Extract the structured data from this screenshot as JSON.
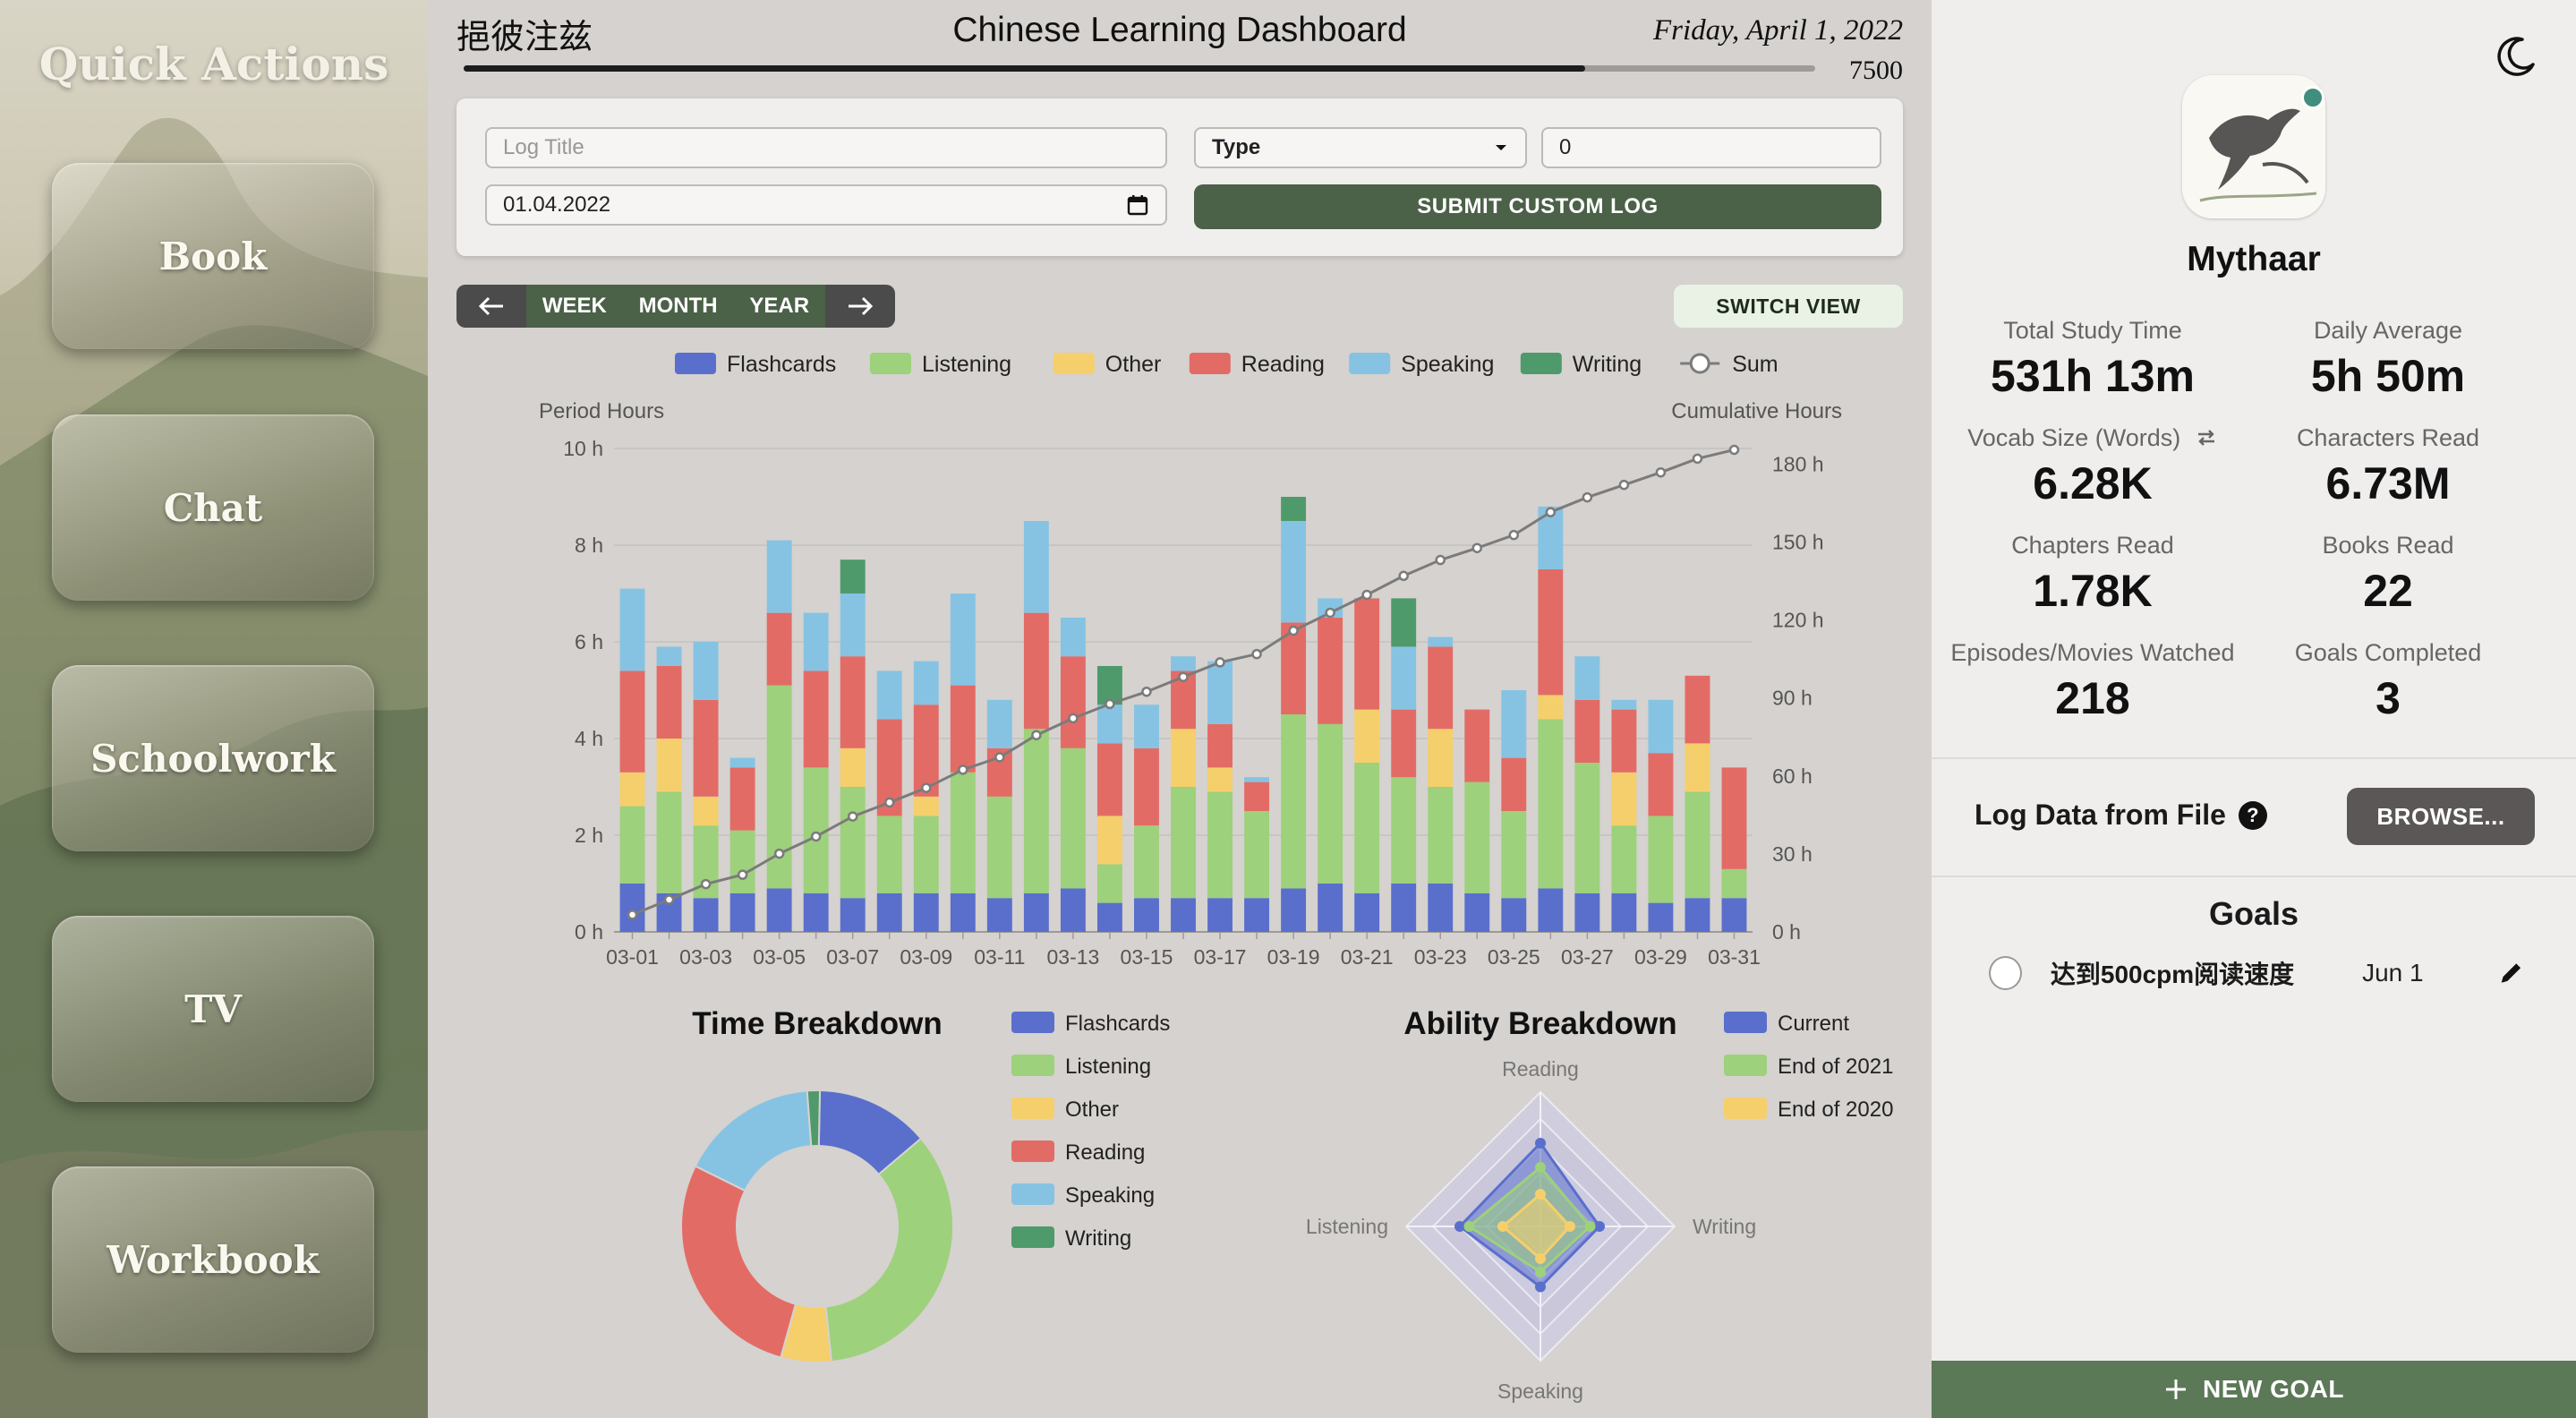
{
  "sidebar": {
    "title": "Quick Actions",
    "items": [
      {
        "label": "Book"
      },
      {
        "label": "Chat"
      },
      {
        "label": "Schoolwork"
      },
      {
        "label": "TV"
      },
      {
        "label": "Workbook"
      }
    ]
  },
  "header": {
    "calligraphy": "挹彼注兹",
    "title": "Chinese Learning Dashboard",
    "date": "Friday, April 1, 2022",
    "progress_label": "7500",
    "progress_fraction": 0.83
  },
  "log_form": {
    "title_placeholder": "Log Title",
    "type_label": "Type",
    "amount_value": "0",
    "date_value": "01.04.2022",
    "submit_label": "SUBMIT CUSTOM LOG"
  },
  "range_nav": {
    "week": "WEEK",
    "month": "MONTH",
    "year": "YEAR"
  },
  "switch_view_label": "SWITCH VIEW",
  "colors": {
    "Flashcards": "#5a6fcc",
    "Listening": "#9dd17b",
    "Other": "#f5cf6b",
    "Reading": "#e36b66",
    "Speaking": "#86c3e3",
    "Writing": "#4f9a6b",
    "Sum": "#7b7b7b"
  },
  "chart_data": [
    {
      "type": "bar",
      "stacked": true,
      "left_axis_label": "Period Hours",
      "right_axis_label": "Cumulative Hours",
      "ylim": [
        0,
        10
      ],
      "y2lim": [
        0,
        186
      ],
      "yticks": [
        "0 h",
        "2 h",
        "4 h",
        "6 h",
        "8 h",
        "10 h"
      ],
      "y2ticks": [
        "0 h",
        "30 h",
        "60 h",
        "90 h",
        "120 h",
        "150 h",
        "180 h"
      ],
      "legend": [
        "Flashcards",
        "Listening",
        "Other",
        "Reading",
        "Speaking",
        "Writing",
        "Sum"
      ],
      "categories": [
        "03-01",
        "03-02",
        "03-03",
        "03-04",
        "03-05",
        "03-06",
        "03-07",
        "03-08",
        "03-09",
        "03-10",
        "03-11",
        "03-12",
        "03-13",
        "03-14",
        "03-15",
        "03-16",
        "03-17",
        "03-18",
        "03-19",
        "03-20",
        "03-21",
        "03-22",
        "03-23",
        "03-24",
        "03-25",
        "03-26",
        "03-27",
        "03-28",
        "03-29",
        "03-30",
        "03-31"
      ],
      "tick_labels": [
        "03-01",
        "03-03",
        "03-05",
        "03-07",
        "03-09",
        "03-11",
        "03-13",
        "03-15",
        "03-17",
        "03-19",
        "03-21",
        "03-23",
        "03-25",
        "03-27",
        "03-29",
        "03-31"
      ],
      "series": [
        {
          "name": "Flashcards",
          "values": [
            1.0,
            0.8,
            0.7,
            0.8,
            0.9,
            0.8,
            0.7,
            0.8,
            0.8,
            0.8,
            0.7,
            0.8,
            0.9,
            0.6,
            0.7,
            0.7,
            0.7,
            0.7,
            0.9,
            1.0,
            0.8,
            1.0,
            1.0,
            0.8,
            0.7,
            0.9,
            0.8,
            0.8,
            0.6,
            0.7,
            0.7
          ]
        },
        {
          "name": "Listening",
          "values": [
            1.6,
            2.1,
            1.5,
            1.3,
            4.2,
            2.6,
            2.3,
            1.6,
            1.6,
            2.5,
            2.1,
            3.4,
            2.9,
            0.8,
            1.5,
            2.3,
            2.2,
            1.8,
            3.6,
            3.3,
            2.7,
            2.2,
            2.0,
            2.3,
            1.8,
            3.5,
            2.7,
            1.4,
            1.8,
            2.2,
            0.6
          ]
        },
        {
          "name": "Other",
          "values": [
            0.7,
            1.1,
            0.6,
            0,
            0,
            0,
            0.8,
            0,
            0.4,
            0,
            0,
            0,
            0,
            1.0,
            0,
            1.2,
            0.5,
            0,
            0,
            0,
            1.1,
            0,
            1.2,
            0,
            0,
            0.5,
            0,
            1.1,
            0,
            1.0,
            0
          ]
        },
        {
          "name": "Reading",
          "values": [
            2.1,
            1.5,
            2.0,
            1.3,
            1.5,
            2.0,
            1.9,
            2.0,
            1.9,
            1.8,
            1.0,
            2.4,
            1.9,
            1.5,
            1.6,
            1.2,
            0.9,
            0.6,
            1.9,
            2.2,
            2.3,
            1.4,
            1.7,
            1.5,
            1.1,
            2.6,
            1.3,
            1.3,
            1.3,
            1.4,
            2.1
          ]
        },
        {
          "name": "Speaking",
          "values": [
            1.7,
            0.4,
            1.2,
            0.2,
            1.5,
            1.2,
            1.3,
            1.0,
            0.9,
            1.9,
            1.0,
            1.9,
            0.8,
            0.8,
            0.9,
            0.3,
            1.3,
            0.1,
            2.1,
            0.4,
            0,
            1.3,
            0.2,
            0,
            1.4,
            1.3,
            0.9,
            0.2,
            1.1,
            0,
            0
          ]
        },
        {
          "name": "Writing",
          "values": [
            0,
            0,
            0,
            0,
            0,
            0,
            0.7,
            0,
            0,
            0,
            0,
            0,
            0,
            0.8,
            0,
            0,
            0,
            0,
            0.5,
            0,
            0,
            1.0,
            0,
            0,
            0,
            0,
            0,
            0,
            0,
            0,
            0
          ]
        }
      ],
      "sum_line": {
        "name": "Sum",
        "values": [
          6.6,
          12.4,
          18.4,
          22.0,
          30.1,
          36.7,
          44.4,
          49.8,
          55.4,
          62.4,
          67.2,
          75.7,
          82.2,
          87.7,
          92.4,
          98.1,
          103.7,
          106.9,
          115.9,
          122.8,
          129.7,
          137.0,
          143.1,
          147.7,
          152.7,
          161.5,
          167.2,
          172.0,
          176.8,
          182.1,
          185.5
        ]
      }
    },
    {
      "type": "pie",
      "donut": true,
      "title": "Time Breakdown",
      "categories": [
        "Flashcards",
        "Listening",
        "Other",
        "Reading",
        "Speaking",
        "Writing"
      ],
      "values": [
        13.5,
        34.5,
        6.0,
        28.0,
        16.5,
        1.5
      ]
    },
    {
      "type": "radar",
      "title": "Ability Breakdown",
      "axes": [
        "Reading",
        "Writing",
        "Speaking",
        "Listening"
      ],
      "series": [
        {
          "name": "Current",
          "values": [
            0.62,
            0.44,
            0.45,
            0.6
          ]
        },
        {
          "name": "End of 2021",
          "values": [
            0.44,
            0.37,
            0.34,
            0.53
          ]
        },
        {
          "name": "End of 2020",
          "values": [
            0.24,
            0.22,
            0.24,
            0.28
          ]
        }
      ],
      "series_colors": [
        "#5a6fcc",
        "#9dd17b",
        "#f5cf6b"
      ]
    }
  ],
  "profile": {
    "username": "Mythaar",
    "stats": [
      {
        "label": "Total Study Time",
        "value": "531h 13m"
      },
      {
        "label": "Daily Average",
        "value": "5h 50m"
      },
      {
        "label": "Vocab Size (Words)",
        "value": "6.28K"
      },
      {
        "label": "Characters Read",
        "value": "6.73M"
      },
      {
        "label": "Chapters Read",
        "value": "1.78K"
      },
      {
        "label": "Books Read",
        "value": "22"
      },
      {
        "label": "Episodes/Movies Watched",
        "value": "218"
      },
      {
        "label": "Goals Completed",
        "value": "3"
      }
    ]
  },
  "log_file": {
    "label": "Log Data from File",
    "browse_label": "BROWSE..."
  },
  "goals": {
    "title": "Goals",
    "items": [
      {
        "text": "达到500cpm阅读速度",
        "date": "Jun 1"
      }
    ],
    "new_goal_label": "NEW GOAL"
  }
}
